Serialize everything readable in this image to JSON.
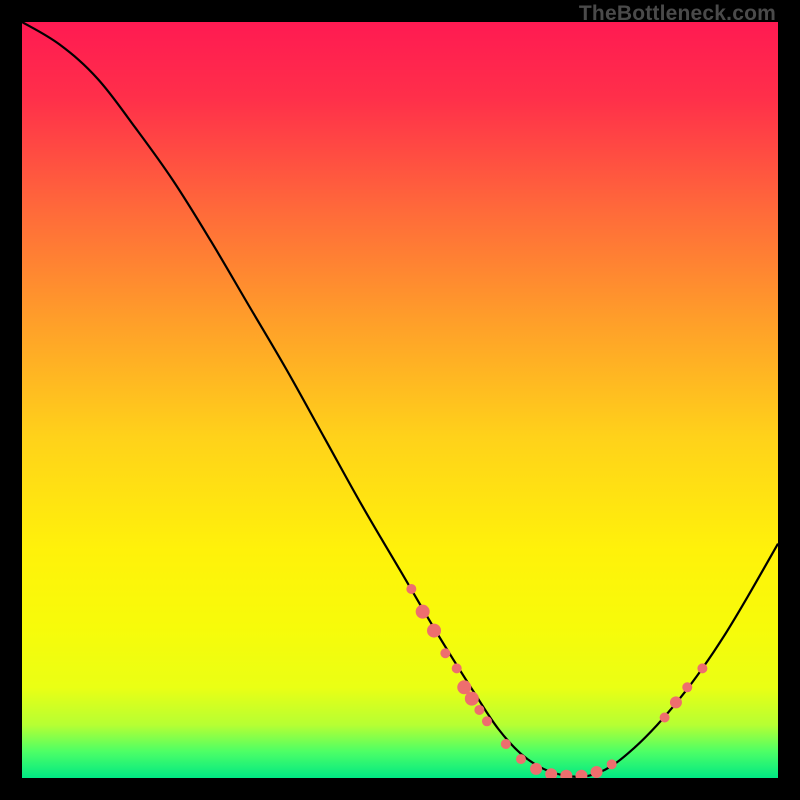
{
  "watermark": "TheBottleneck.com",
  "chart_data": {
    "type": "line",
    "title": "",
    "xlabel": "",
    "ylabel": "",
    "xlim": [
      0,
      100
    ],
    "ylim": [
      0,
      100
    ],
    "grid": false,
    "series": [
      {
        "name": "curve",
        "x": [
          0,
          5,
          10,
          15,
          20,
          25,
          30,
          35,
          40,
          45,
          50,
          55,
          60,
          63,
          66,
          69,
          72,
          75,
          78,
          81,
          84,
          87,
          90,
          93,
          96,
          100
        ],
        "y": [
          100,
          97,
          92.5,
          86,
          79,
          71,
          62.5,
          54,
          45,
          36,
          27.5,
          19,
          11,
          6.5,
          3.2,
          1.2,
          0.3,
          0.3,
          1.6,
          4.0,
          7.0,
          10.5,
          14.5,
          19,
          24,
          31
        ]
      }
    ],
    "markers": [
      {
        "x": 51.5,
        "y": 25.0,
        "r": 5
      },
      {
        "x": 53.0,
        "y": 22.0,
        "r": 7
      },
      {
        "x": 54.5,
        "y": 19.5,
        "r": 7
      },
      {
        "x": 56.0,
        "y": 16.5,
        "r": 5
      },
      {
        "x": 57.5,
        "y": 14.5,
        "r": 5
      },
      {
        "x": 58.5,
        "y": 12.0,
        "r": 7
      },
      {
        "x": 59.5,
        "y": 10.5,
        "r": 7
      },
      {
        "x": 60.5,
        "y": 9.0,
        "r": 5
      },
      {
        "x": 61.5,
        "y": 7.5,
        "r": 5
      },
      {
        "x": 64.0,
        "y": 4.5,
        "r": 5
      },
      {
        "x": 66.0,
        "y": 2.5,
        "r": 5
      },
      {
        "x": 68.0,
        "y": 1.2,
        "r": 6
      },
      {
        "x": 70.0,
        "y": 0.5,
        "r": 6
      },
      {
        "x": 72.0,
        "y": 0.3,
        "r": 6
      },
      {
        "x": 74.0,
        "y": 0.3,
        "r": 6
      },
      {
        "x": 76.0,
        "y": 0.8,
        "r": 6
      },
      {
        "x": 78.0,
        "y": 1.8,
        "r": 5
      },
      {
        "x": 85.0,
        "y": 8.0,
        "r": 5
      },
      {
        "x": 86.5,
        "y": 10.0,
        "r": 6
      },
      {
        "x": 88.0,
        "y": 12.0,
        "r": 5
      },
      {
        "x": 90.0,
        "y": 14.5,
        "r": 5
      }
    ],
    "gradient_stops": [
      {
        "offset": 0.0,
        "color": "#ff1a52"
      },
      {
        "offset": 0.1,
        "color": "#ff2f4a"
      },
      {
        "offset": 0.25,
        "color": "#ff6a3a"
      },
      {
        "offset": 0.4,
        "color": "#ffa029"
      },
      {
        "offset": 0.55,
        "color": "#ffd21a"
      },
      {
        "offset": 0.7,
        "color": "#fff20a"
      },
      {
        "offset": 0.8,
        "color": "#f7fb0a"
      },
      {
        "offset": 0.88,
        "color": "#eaff14"
      },
      {
        "offset": 0.93,
        "color": "#b6ff33"
      },
      {
        "offset": 0.965,
        "color": "#4dff66"
      },
      {
        "offset": 1.0,
        "color": "#00e884"
      }
    ],
    "marker_color": "#ee6e6e",
    "curve_color": "#000000"
  }
}
